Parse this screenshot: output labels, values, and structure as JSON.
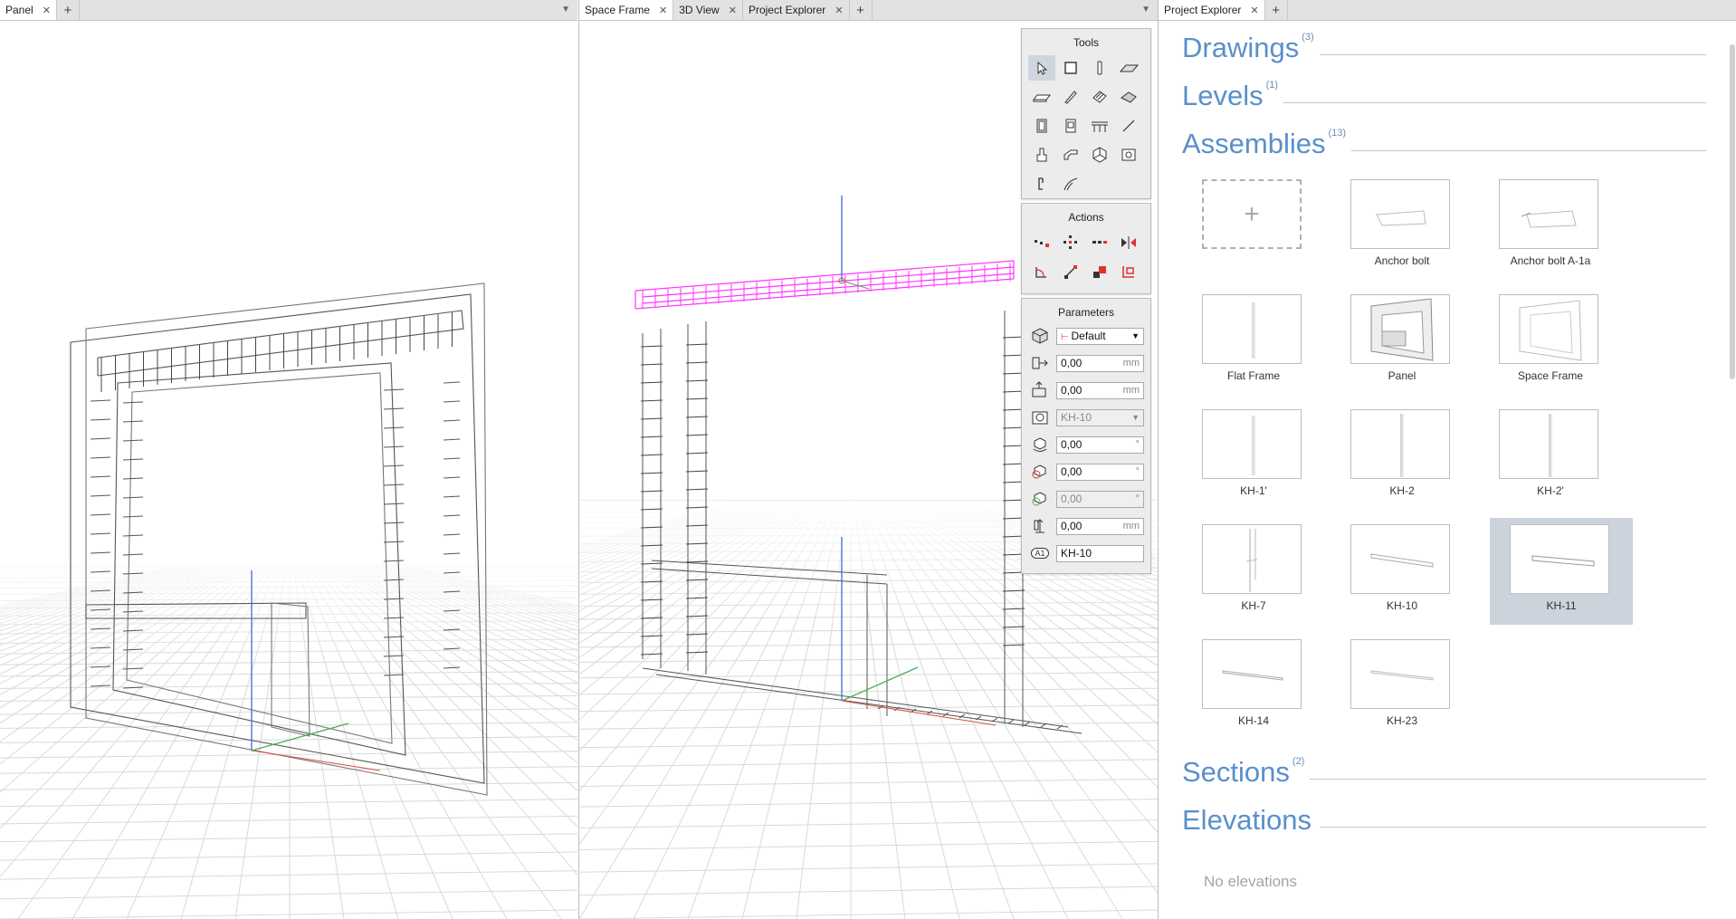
{
  "left_pane": {
    "tabs": [
      {
        "label": "Panel"
      }
    ]
  },
  "mid_pane": {
    "tabs": [
      {
        "label": "Space Frame"
      },
      {
        "label": "3D View"
      },
      {
        "label": "Project Explorer"
      }
    ],
    "tools": {
      "title": "Tools"
    },
    "actions": {
      "title": "Actions"
    },
    "parameters": {
      "title": "Parameters",
      "fields": [
        {
          "value": "Default",
          "unit": ""
        },
        {
          "value": "0,00",
          "unit": "mm"
        },
        {
          "value": "0,00",
          "unit": "mm"
        },
        {
          "value": "KH-10",
          "unit": ""
        },
        {
          "value": "0,00",
          "unit": "°"
        },
        {
          "value": "0,00",
          "unit": "°"
        },
        {
          "value": "0,00",
          "unit": "°"
        },
        {
          "value": "0,00",
          "unit": "mm"
        },
        {
          "value": "KH-10",
          "unit": ""
        }
      ],
      "name_badge": "A1"
    }
  },
  "right_pane": {
    "tabs": [
      {
        "label": "Project Explorer"
      }
    ],
    "sections": {
      "drawings": {
        "title": "Drawings",
        "count": "(3)"
      },
      "levels": {
        "title": "Levels",
        "count": "(1)"
      },
      "assemblies": {
        "title": "Assemblies",
        "count": "(13)"
      },
      "sections": {
        "title": "Sections",
        "count": "(2)"
      },
      "elevations": {
        "title": "Elevations",
        "count": ""
      }
    },
    "add_symbol": "+",
    "assemblies": [
      {
        "label": "Anchor bolt"
      },
      {
        "label": "Anchor bolt A-1a"
      },
      {
        "label": "Flat Frame"
      },
      {
        "label": "Panel"
      },
      {
        "label": "Space Frame"
      },
      {
        "label": "KH-1'"
      },
      {
        "label": "KH-2"
      },
      {
        "label": "KH-2'"
      },
      {
        "label": "KH-7"
      },
      {
        "label": "KH-10"
      },
      {
        "label": "KH-11"
      },
      {
        "label": "KH-14"
      },
      {
        "label": "KH-23"
      }
    ],
    "selected_assembly": "KH-11",
    "no_elevations": "No elevations"
  },
  "colors": {
    "accent": "#5a8fcb",
    "selection": "#ff33ff",
    "axis_x": "#d9534f",
    "axis_y": "#4caf50",
    "axis_z": "#3a6fd8"
  }
}
